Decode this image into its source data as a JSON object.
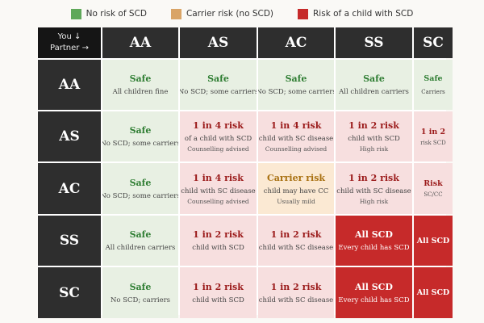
{
  "colors": {
    "safe_swatch": "#5fa85a",
    "carrier_swatch": "#d9a466",
    "high_swatch": "#c62a2a",
    "safe_bg": "#e8f0e3",
    "risk_bg": "#f7dfdf",
    "carrier_bg": "#fbe9d3",
    "high_bg": "#c62a2a",
    "header_bg": "#2e2e2e"
  },
  "legend": [
    {
      "label": "No risk of SCD",
      "color": "#5fa85a"
    },
    {
      "label": "Carrier risk (no SCD)",
      "color": "#d9a466"
    },
    {
      "label": "Risk of a child with SCD",
      "color": "#c62a2a"
    }
  ],
  "corner": {
    "line1": "You ↓",
    "line2": "Partner →"
  },
  "columns": [
    "AA",
    "AS",
    "AC",
    "SS",
    "SC"
  ],
  "rows": [
    {
      "label": "AA",
      "cells": [
        {
          "status": "safe",
          "title": "Safe",
          "sub1": "All children fine",
          "sub2": ""
        },
        {
          "status": "safe",
          "title": "Safe",
          "sub1": "No SCD; some carriers",
          "sub2": ""
        },
        {
          "status": "safe",
          "title": "Safe",
          "sub1": "No SCD; some carriers",
          "sub2": ""
        },
        {
          "status": "safe",
          "title": "Safe",
          "sub1": "All children carriers",
          "sub2": ""
        },
        {
          "status": "safe",
          "title": "Safe",
          "sub1": "Carriers",
          "sub2": ""
        }
      ]
    },
    {
      "label": "AS",
      "cells": [
        {
          "status": "safe",
          "title": "Safe",
          "sub1": "No SCD; some carriers",
          "sub2": ""
        },
        {
          "status": "risk",
          "title": "1 in 4 risk",
          "sub1": "of a child with SCD",
          "sub2": "Counselling advised"
        },
        {
          "status": "risk",
          "title": "1 in 4 risk",
          "sub1": "child with SC disease",
          "sub2": "Counselling advised"
        },
        {
          "status": "risk",
          "title": "1 in 2 risk",
          "sub1": "child with SCD",
          "sub2": "High risk"
        },
        {
          "status": "risk",
          "title": "1 in 2",
          "sub1": "",
          "sub2": "risk SCD"
        }
      ]
    },
    {
      "label": "AC",
      "cells": [
        {
          "status": "safe",
          "title": "Safe",
          "sub1": "No SCD; some carriers",
          "sub2": ""
        },
        {
          "status": "risk",
          "title": "1 in 4 risk",
          "sub1": "child with SC disease",
          "sub2": "Counselling advised"
        },
        {
          "status": "carrier",
          "title": "Carrier risk",
          "sub1": "child may have CC",
          "sub2": "Usually mild"
        },
        {
          "status": "risk",
          "title": "1 in 2 risk",
          "sub1": "child with SC disease",
          "sub2": "High risk"
        },
        {
          "status": "risk",
          "title": "Risk",
          "sub1": "",
          "sub2": "SC/CC"
        }
      ]
    },
    {
      "label": "SS",
      "cells": [
        {
          "status": "safe",
          "title": "Safe",
          "sub1": "All children carriers",
          "sub2": ""
        },
        {
          "status": "risk",
          "title": "1 in 2 risk",
          "sub1": "child with SCD",
          "sub2": ""
        },
        {
          "status": "risk",
          "title": "1 in 2 risk",
          "sub1": "child with SC disease",
          "sub2": ""
        },
        {
          "status": "high",
          "title": "All SCD",
          "sub1": "Every child has SCD",
          "sub2": ""
        },
        {
          "status": "high",
          "title": "All SCD",
          "sub1": "",
          "sub2": ""
        }
      ]
    },
    {
      "label": "SC",
      "cells": [
        {
          "status": "safe",
          "title": "Safe",
          "sub1": "No SCD; carriers",
          "sub2": ""
        },
        {
          "status": "risk",
          "title": "1 in 2 risk",
          "sub1": "child with SCD",
          "sub2": ""
        },
        {
          "status": "risk",
          "title": "1 in 2 risk",
          "sub1": "child with SC disease",
          "sub2": ""
        },
        {
          "status": "high",
          "title": "All SCD",
          "sub1": "Every child has SCD",
          "sub2": ""
        },
        {
          "status": "high",
          "title": "All SCD",
          "sub1": "",
          "sub2": ""
        }
      ]
    }
  ]
}
